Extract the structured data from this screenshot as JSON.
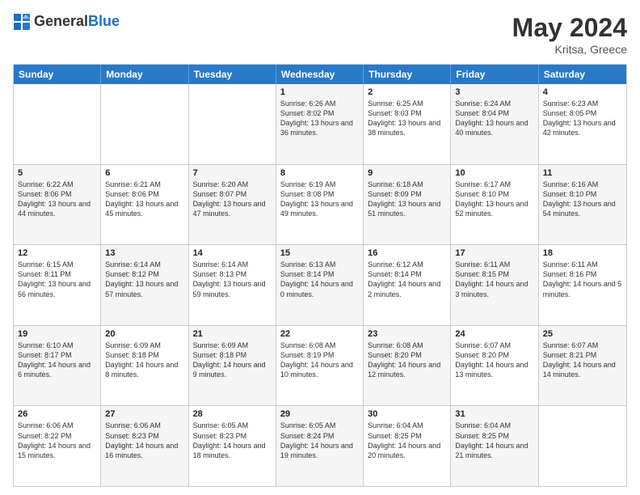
{
  "header": {
    "logo_general": "General",
    "logo_blue": "Blue",
    "title": "May 2024",
    "subtitle": "Kritsa, Greece"
  },
  "calendar": {
    "days_of_week": [
      "Sunday",
      "Monday",
      "Tuesday",
      "Wednesday",
      "Thursday",
      "Friday",
      "Saturday"
    ],
    "rows": [
      [
        {
          "day": "",
          "info": "",
          "alt": false
        },
        {
          "day": "",
          "info": "",
          "alt": false
        },
        {
          "day": "",
          "info": "",
          "alt": false
        },
        {
          "day": "1",
          "info": "Sunrise: 6:26 AM\nSunset: 8:02 PM\nDaylight: 13 hours and 36 minutes.",
          "alt": true
        },
        {
          "day": "2",
          "info": "Sunrise: 6:25 AM\nSunset: 8:03 PM\nDaylight: 13 hours and 38 minutes.",
          "alt": false
        },
        {
          "day": "3",
          "info": "Sunrise: 6:24 AM\nSunset: 8:04 PM\nDaylight: 13 hours and 40 minutes.",
          "alt": true
        },
        {
          "day": "4",
          "info": "Sunrise: 6:23 AM\nSunset: 8:05 PM\nDaylight: 13 hours and 42 minutes.",
          "alt": false
        }
      ],
      [
        {
          "day": "5",
          "info": "Sunrise: 6:22 AM\nSunset: 8:06 PM\nDaylight: 13 hours and 44 minutes.",
          "alt": true
        },
        {
          "day": "6",
          "info": "Sunrise: 6:21 AM\nSunset: 8:06 PM\nDaylight: 13 hours and 45 minutes.",
          "alt": false
        },
        {
          "day": "7",
          "info": "Sunrise: 6:20 AM\nSunset: 8:07 PM\nDaylight: 13 hours and 47 minutes.",
          "alt": true
        },
        {
          "day": "8",
          "info": "Sunrise: 6:19 AM\nSunset: 8:08 PM\nDaylight: 13 hours and 49 minutes.",
          "alt": false
        },
        {
          "day": "9",
          "info": "Sunrise: 6:18 AM\nSunset: 8:09 PM\nDaylight: 13 hours and 51 minutes.",
          "alt": true
        },
        {
          "day": "10",
          "info": "Sunrise: 6:17 AM\nSunset: 8:10 PM\nDaylight: 13 hours and 52 minutes.",
          "alt": false
        },
        {
          "day": "11",
          "info": "Sunrise: 6:16 AM\nSunset: 8:10 PM\nDaylight: 13 hours and 54 minutes.",
          "alt": true
        }
      ],
      [
        {
          "day": "12",
          "info": "Sunrise: 6:15 AM\nSunset: 8:11 PM\nDaylight: 13 hours and 56 minutes.",
          "alt": false
        },
        {
          "day": "13",
          "info": "Sunrise: 6:14 AM\nSunset: 8:12 PM\nDaylight: 13 hours and 57 minutes.",
          "alt": true
        },
        {
          "day": "14",
          "info": "Sunrise: 6:14 AM\nSunset: 8:13 PM\nDaylight: 13 hours and 59 minutes.",
          "alt": false
        },
        {
          "day": "15",
          "info": "Sunrise: 6:13 AM\nSunset: 8:14 PM\nDaylight: 14 hours and 0 minutes.",
          "alt": true
        },
        {
          "day": "16",
          "info": "Sunrise: 6:12 AM\nSunset: 8:14 PM\nDaylight: 14 hours and 2 minutes.",
          "alt": false
        },
        {
          "day": "17",
          "info": "Sunrise: 6:11 AM\nSunset: 8:15 PM\nDaylight: 14 hours and 3 minutes.",
          "alt": true
        },
        {
          "day": "18",
          "info": "Sunrise: 6:11 AM\nSunset: 8:16 PM\nDaylight: 14 hours and 5 minutes.",
          "alt": false
        }
      ],
      [
        {
          "day": "19",
          "info": "Sunrise: 6:10 AM\nSunset: 8:17 PM\nDaylight: 14 hours and 6 minutes.",
          "alt": true
        },
        {
          "day": "20",
          "info": "Sunrise: 6:09 AM\nSunset: 8:18 PM\nDaylight: 14 hours and 8 minutes.",
          "alt": false
        },
        {
          "day": "21",
          "info": "Sunrise: 6:09 AM\nSunset: 8:18 PM\nDaylight: 14 hours and 9 minutes.",
          "alt": true
        },
        {
          "day": "22",
          "info": "Sunrise: 6:08 AM\nSunset: 8:19 PM\nDaylight: 14 hours and 10 minutes.",
          "alt": false
        },
        {
          "day": "23",
          "info": "Sunrise: 6:08 AM\nSunset: 8:20 PM\nDaylight: 14 hours and 12 minutes.",
          "alt": true
        },
        {
          "day": "24",
          "info": "Sunrise: 6:07 AM\nSunset: 8:20 PM\nDaylight: 14 hours and 13 minutes.",
          "alt": false
        },
        {
          "day": "25",
          "info": "Sunrise: 6:07 AM\nSunset: 8:21 PM\nDaylight: 14 hours and 14 minutes.",
          "alt": true
        }
      ],
      [
        {
          "day": "26",
          "info": "Sunrise: 6:06 AM\nSunset: 8:22 PM\nDaylight: 14 hours and 15 minutes.",
          "alt": false
        },
        {
          "day": "27",
          "info": "Sunrise: 6:06 AM\nSunset: 8:23 PM\nDaylight: 14 hours and 16 minutes.",
          "alt": true
        },
        {
          "day": "28",
          "info": "Sunrise: 6:05 AM\nSunset: 8:23 PM\nDaylight: 14 hours and 18 minutes.",
          "alt": false
        },
        {
          "day": "29",
          "info": "Sunrise: 6:05 AM\nSunset: 8:24 PM\nDaylight: 14 hours and 19 minutes.",
          "alt": true
        },
        {
          "day": "30",
          "info": "Sunrise: 6:04 AM\nSunset: 8:25 PM\nDaylight: 14 hours and 20 minutes.",
          "alt": false
        },
        {
          "day": "31",
          "info": "Sunrise: 6:04 AM\nSunset: 8:25 PM\nDaylight: 14 hours and 21 minutes.",
          "alt": true
        },
        {
          "day": "",
          "info": "",
          "alt": false
        }
      ]
    ]
  }
}
